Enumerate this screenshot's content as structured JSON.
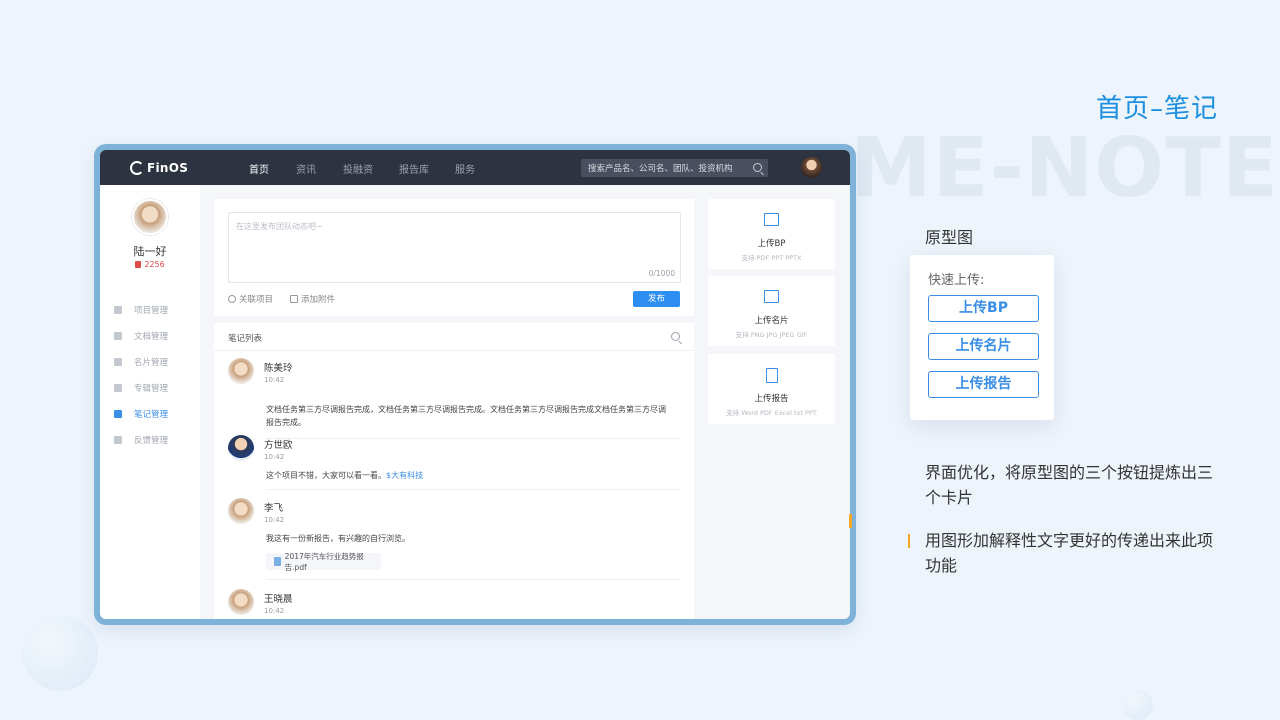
{
  "slide": {
    "title": "首页–笔记",
    "watermark": "ME-NOTE",
    "section_label": "原型图",
    "prototype": {
      "title": "快速上传:",
      "buttons": [
        "上传BP",
        "上传名片",
        "上传报告"
      ]
    },
    "desc_1": "界面优化，将原型图的三个按钮提炼出三个卡片",
    "desc_2": "用图形加解释性文字更好的传递出来此项功能",
    "colors": {
      "accent": "#1b8fe2",
      "highlight": "#f5a623"
    }
  },
  "app": {
    "logo_text": "FinOS",
    "nav": [
      "首页",
      "资讯",
      "投融资",
      "报告库",
      "服务"
    ],
    "nav_active": "首页",
    "search_placeholder": "搜索产品名、公司名、团队、投资机构",
    "user": {
      "name": "陆一好",
      "points": "2256"
    },
    "menu": [
      {
        "label": "项目管理",
        "icon": "list-icon"
      },
      {
        "label": "文档管理",
        "icon": "folder-icon"
      },
      {
        "label": "名片管理",
        "icon": "card-icon"
      },
      {
        "label": "专辑管理",
        "icon": "grid-icon"
      },
      {
        "label": "笔记管理",
        "icon": "note-icon",
        "active": true
      },
      {
        "label": "反馈管理",
        "icon": "chat-icon"
      }
    ],
    "composer": {
      "placeholder": "在这里发布团队动态吧~",
      "counter": "0/1000",
      "link_project": "关联项目",
      "link_attach": "添加附件",
      "publish": "发布"
    },
    "notes_title": "笔记列表",
    "notes": [
      {
        "name": "陈美玲",
        "time": "10:42",
        "text": "文档任务第三方尽调报告完成，文档任务第三方尽调报告完成。文档任务第三方尽调报告完成文档任务第三方尽调报告完成。"
      },
      {
        "name": "方世欧",
        "time": "10:42",
        "text": "这个项目不错，大家可以看一看。",
        "tag": "$大有科技"
      },
      {
        "name": "李飞",
        "time": "10:42",
        "text": "我这有一份新报告，有兴趣的自行浏览。",
        "attachment": "2017年汽车行业趋势报告.pdf"
      },
      {
        "name": "王晓晨",
        "time": "10:42"
      }
    ],
    "cards": [
      {
        "title": "上传BP",
        "sub": "支持.PDF PPT PPTX",
        "icon": "folder-icon"
      },
      {
        "title": "上传名片",
        "sub": "支持.PNG JPG JPEG GIF",
        "icon": "image-icon"
      },
      {
        "title": "上传报告",
        "sub": "支持.Word PDF Excel txt PPT",
        "icon": "document-icon"
      }
    ]
  }
}
